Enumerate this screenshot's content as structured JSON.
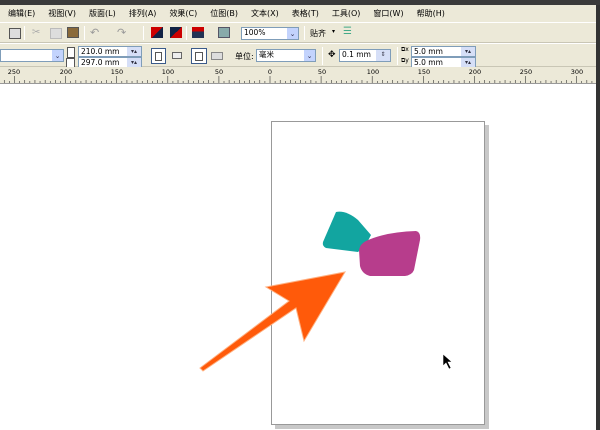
{
  "menu": [
    "编辑(E)",
    "视图(V)",
    "版面(L)",
    "排列(A)",
    "效果(C)",
    "位图(B)",
    "文本(X)",
    "表格(T)",
    "工具(O)",
    "窗口(W)",
    "帮助(H)"
  ],
  "toolbar": {
    "zoom": "100%",
    "snap": "贴齐"
  },
  "property_bar": {
    "width": "210.0 mm",
    "height": "297.0 mm",
    "unit_label": "单位:",
    "unit": "毫米",
    "nudge": "0.1 mm",
    "dup_x": "5.0 mm",
    "dup_y": "5.0 mm"
  },
  "ruler": {
    "labels": [
      "250",
      "200",
      "150",
      "100",
      "50",
      "0",
      "50",
      "100",
      "150",
      "200",
      "250",
      "300"
    ]
  },
  "colors": {
    "teal": "#12a5a0",
    "magenta": "#b73d8c",
    "arrow": "#ff5a0a"
  }
}
